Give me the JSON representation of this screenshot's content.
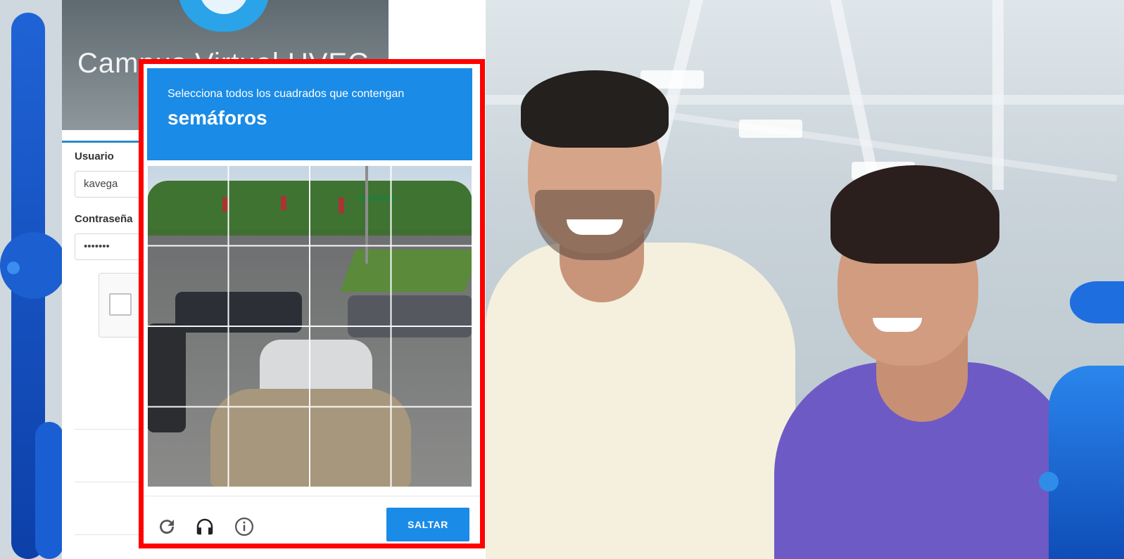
{
  "login": {
    "title": "Campus Virtual UVEG",
    "username_label": "Usuario",
    "username_value": "kavega",
    "password_label": "Contraseña",
    "password_value": "•••••••"
  },
  "captcha": {
    "instruction": "Selecciona todos los cuadrados que contengan",
    "target": "semáforos",
    "grid_rows": 4,
    "grid_cols": 4,
    "footer_icons": [
      "reload-icon",
      "headphones-icon",
      "info-icon"
    ],
    "skip_label": "SALTAR",
    "accent_color": "#1a8be6",
    "highlight_border_color": "#ff0000"
  }
}
